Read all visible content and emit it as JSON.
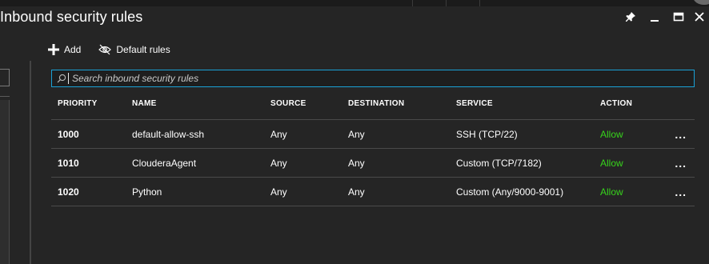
{
  "window": {
    "title": "Inbound security rules",
    "controls": [
      "pin-icon",
      "minimize-icon",
      "maximize-icon",
      "close-icon"
    ]
  },
  "toolbar": {
    "add_label": "Add",
    "default_rules_label": "Default rules"
  },
  "search": {
    "placeholder": "Search inbound security rules",
    "value": ""
  },
  "table": {
    "headers": {
      "priority": "PRIORITY",
      "name": "NAME",
      "source": "SOURCE",
      "destination": "DESTINATION",
      "service": "SERVICE",
      "action": "ACTION"
    },
    "rows": [
      {
        "priority": "1000",
        "name": "default-allow-ssh",
        "source": "Any",
        "destination": "Any",
        "service": "SSH (TCP/22)",
        "action": "Allow",
        "more": "..."
      },
      {
        "priority": "1010",
        "name": "ClouderaAgent",
        "source": "Any",
        "destination": "Any",
        "service": "Custom (TCP/7182)",
        "action": "Allow",
        "more": "..."
      },
      {
        "priority": "1020",
        "name": "Python",
        "source": "Any",
        "destination": "Any",
        "service": "Custom (Any/9000-9001)",
        "action": "Allow",
        "more": "..."
      }
    ]
  },
  "colors": {
    "background": "#252525",
    "accent_border": "#1aa1d6",
    "allow": "#37d41c"
  }
}
